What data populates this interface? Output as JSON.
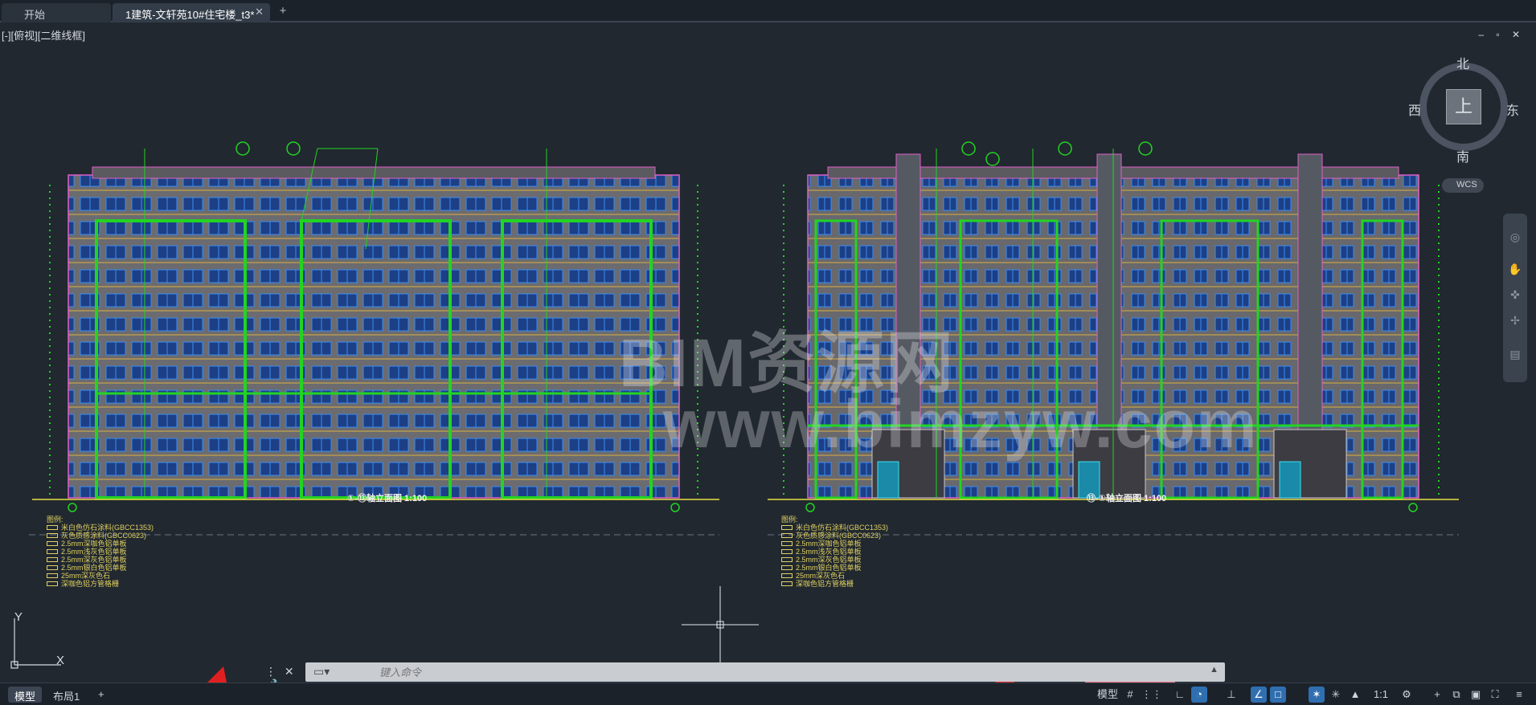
{
  "tabs": [
    {
      "label": "开始",
      "active": false
    },
    {
      "label": "1建筑-文轩苑10#住宅楼_t3*",
      "active": true
    }
  ],
  "tab_close": "✕",
  "new_tab": "+",
  "view_label": "[-][俯视][二维线框]",
  "window_controls": "– ▫ ✕",
  "compass": {
    "north": "北",
    "south": "南",
    "east": "东",
    "west": "西",
    "face": "上"
  },
  "wcs_label": "WCS",
  "ucs": {
    "x": "X",
    "y": "Y"
  },
  "watermark": {
    "line1": "BIM资源网",
    "line2": "www.bimzyw.com"
  },
  "drawings": [
    {
      "title": "①-⑬轴立面图 1:100"
    },
    {
      "title": "⑬-①轴立面图 1:100"
    }
  ],
  "legend": {
    "header": "图例:",
    "items": [
      "米白色仿石涂料(GBCC1353)",
      "灰色质感涂料(GBCC0623)",
      "2.5mm深咖色铝单板",
      "2.5mm浅灰色铝单板",
      "2.5mm深灰色铝单板",
      "2.5mm银白色铝单板",
      "25mm深灰色石",
      "深咖色铝方管格栅"
    ]
  },
  "command": {
    "placeholder": "键入命令"
  },
  "layout_tabs": [
    {
      "label": "模型",
      "active": true
    },
    {
      "label": "布局1",
      "active": false
    }
  ],
  "layout_add": "+",
  "status": {
    "model": "模型",
    "scale": "1:1",
    "icons": [
      "grid-icon",
      "snap-icon",
      "ortho-icon",
      "polar-icon",
      "osnap-icon",
      "otrack-icon",
      "lineweight-icon",
      "annotation-icon",
      "workspace-icon",
      "gear-icon",
      "plus-icon",
      "isolate-icon",
      "hardware-icon",
      "fullscreen-icon",
      "menu-icon"
    ]
  },
  "colors": {
    "background": "#212830",
    "building_fill": "#6b6b70",
    "window": "#2a5fb0",
    "green_line": "#22d422",
    "magenta": "#e060c8",
    "yellow": "#e0d060"
  }
}
